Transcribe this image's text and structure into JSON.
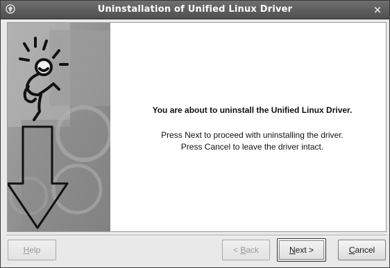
{
  "window": {
    "title": "Uninstallation of Unified Linux Driver",
    "close_label": "×"
  },
  "icons": {
    "title_icon": "app-icon",
    "close_icon": "close-icon",
    "side_art": "running-figure-with-down-arrow"
  },
  "message": {
    "headline": "You are about to uninstall the Unified Linux Driver.",
    "line1": "Press Next to proceed with uninstalling the driver.",
    "line2": "Press Cancel to leave the driver intact."
  },
  "buttons": {
    "help": {
      "mnemonic": "H",
      "rest": "elp"
    },
    "back": {
      "prefix": "< ",
      "mnemonic": "B",
      "rest": "ack"
    },
    "next": {
      "mnemonic": "N",
      "rest": "ext >"
    },
    "cancel": {
      "mnemonic": "C",
      "rest": "ancel"
    }
  },
  "colors": {
    "titlebar": "#5a5a5a",
    "title_text": "#ffffff",
    "dialog_bg": "#e9e9e9",
    "side_art": "#8d8d8d"
  }
}
